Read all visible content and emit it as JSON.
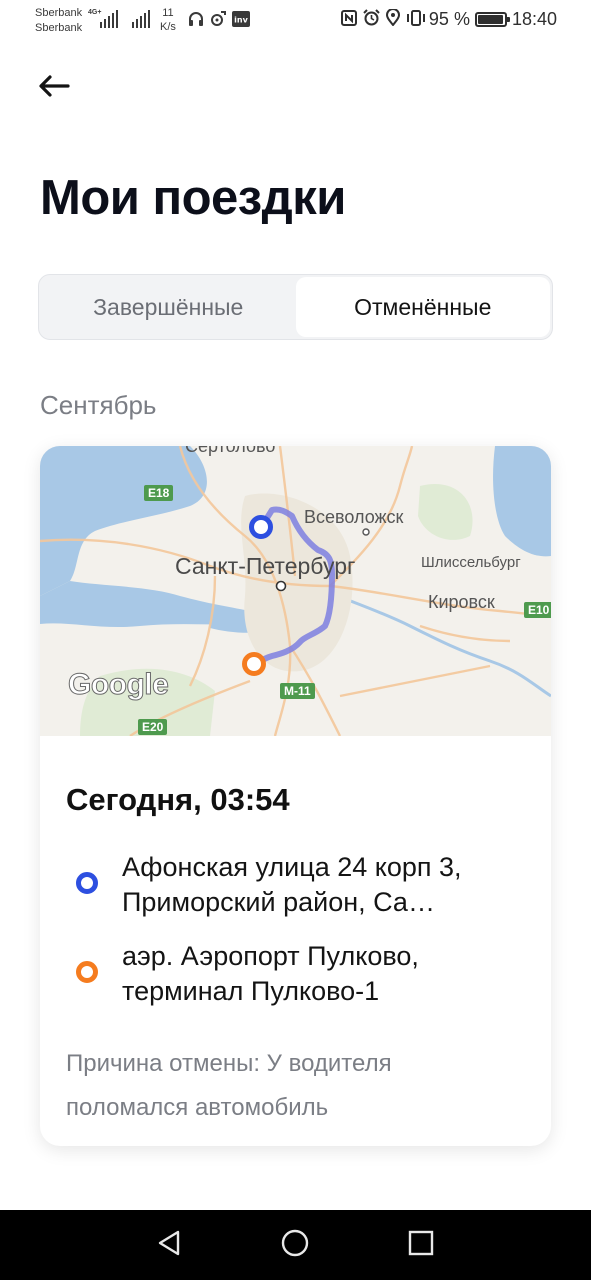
{
  "status_bar": {
    "carrier_1": "Sberbank",
    "carrier_2": "Sberbank",
    "network_type": "4G+",
    "speed_value": "11",
    "speed_unit": "K/s",
    "battery_percent": "95 %",
    "battery_level": 0.95,
    "time": "18:40",
    "icons": [
      "signal-icon",
      "headphones-icon",
      "music-icon",
      "app-icon",
      "nfc-icon",
      "alarm-icon",
      "location-icon",
      "vibrate-icon",
      "battery-icon"
    ]
  },
  "header": {
    "back_icon": "arrow-left-icon",
    "title": "Мои поездки"
  },
  "tabs": [
    {
      "label": "Завершённые",
      "active": false
    },
    {
      "label": "Отменённые",
      "active": true
    }
  ],
  "month": "Сентябрь",
  "trip": {
    "map": {
      "labels": {
        "sertolovo": "Сертолово",
        "vsevolozhsk": "Всеволожск",
        "spb": "Санкт-Петербург",
        "shlisselburg": "Шлиссельбург",
        "kirovsk": "Кировск",
        "e18": "E18",
        "e10": "E10",
        "m11": "M-11",
        "e20": "E20",
        "google": "Google"
      },
      "route_color": "#7e7fe0",
      "start_color": "#2d4fe0",
      "end_color": "#f57c1f"
    },
    "time": "Сегодня, 03:54",
    "from": "Афонская улица 24 корп 3, Приморский район, Са…",
    "to": "аэр. Аэропорт Пулково, терминал Пулково-1",
    "cancel_reason": "Причина отмены: У водителя поломался автомобиль"
  },
  "nav_bar": {
    "back": "nav-back-icon",
    "home": "nav-home-icon",
    "recent": "nav-recent-icon"
  }
}
